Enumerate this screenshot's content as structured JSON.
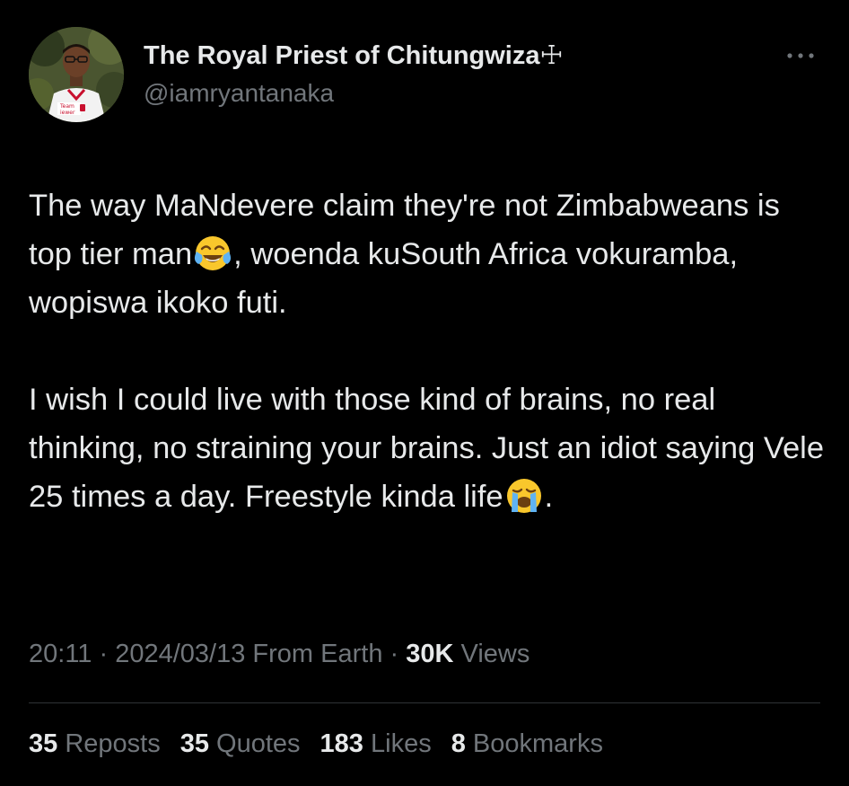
{
  "author": {
    "display_name": "The Royal Priest of Chitungwiza☩",
    "handle": "@iamryantanaka",
    "avatar_shirt_text_1": "Team",
    "avatar_shirt_text_2": "iewer"
  },
  "tweet": {
    "p1_a": "The way MaNdevere claim they're not Zimbabweans is top tier man",
    "p1_b": ", woenda kuSouth Africa vokuramba, wopiswa ikoko futi.",
    "p2_a": "I wish I could live with those kind of brains, no real thinking, no straining your brains. Just an idiot saying Vele 25 times a day. Freestyle kinda life",
    "p2_b": ".",
    "emoji_1": "face-with-tears-of-joy",
    "emoji_2": "loudly-crying-face"
  },
  "meta": {
    "time": "20:11",
    "sep1": " · ",
    "date": "2024/03/13",
    "location": " From Earth",
    "sep2": " · ",
    "views_count": "30K",
    "views_label": " Views"
  },
  "stats": {
    "reposts_count": "35",
    "reposts_label": " Reposts",
    "quotes_count": "35",
    "quotes_label": " Quotes",
    "likes_count": "183",
    "likes_label": " Likes",
    "bookmarks_count": "8",
    "bookmarks_label": " Bookmarks"
  },
  "colors": {
    "background": "#000000",
    "primary_text": "#e7e9ea",
    "secondary_text": "#71767b",
    "divider": "#2f3336"
  }
}
